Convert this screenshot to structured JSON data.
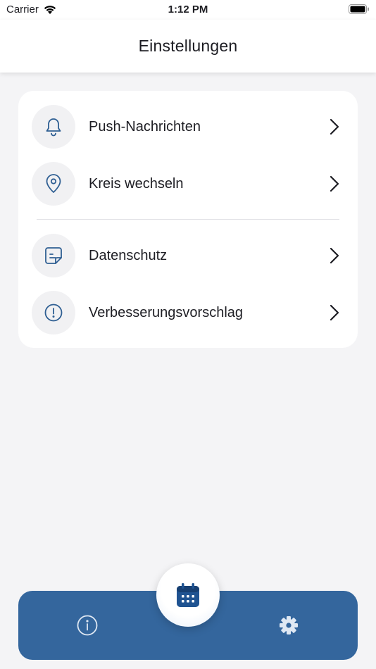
{
  "status_bar": {
    "carrier": "Carrier",
    "time": "1:12 PM"
  },
  "header": {
    "title": "Einstellungen"
  },
  "settings": {
    "items": [
      {
        "label": "Push-Nachrichten",
        "icon": "bell-icon"
      },
      {
        "label": "Kreis wechseln",
        "icon": "location-pin-icon"
      },
      {
        "label": "Datenschutz",
        "icon": "document-icon"
      },
      {
        "label": "Verbesserungsvorschlag",
        "icon": "exclamation-circle-icon"
      }
    ]
  },
  "tabbar": {
    "items": [
      {
        "icon": "info-icon"
      },
      {
        "icon": "calendar-icon"
      },
      {
        "icon": "gear-icon"
      }
    ]
  },
  "colors": {
    "accent": "#34669d",
    "icon": "#2f5f93",
    "background": "#f4f4f6"
  }
}
